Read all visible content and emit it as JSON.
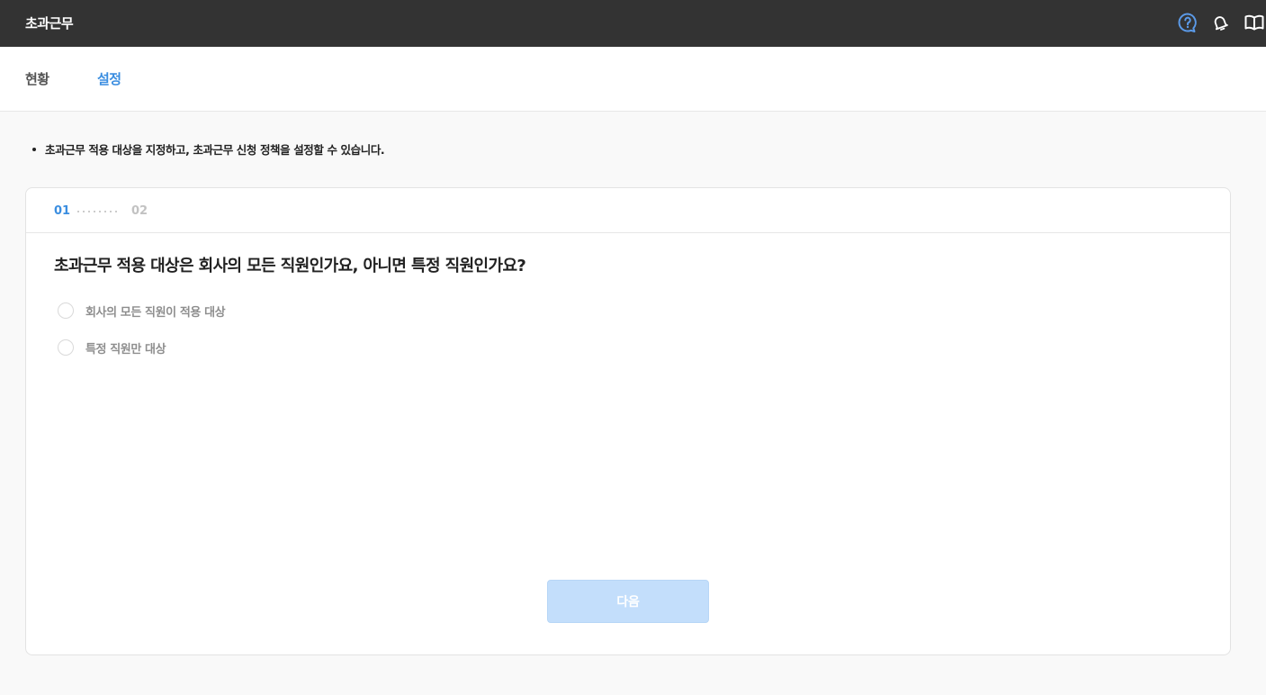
{
  "header": {
    "title": "초과근무",
    "icons": [
      "help-icon",
      "bell-icon",
      "book-icon"
    ],
    "accent_color": "#5b9ae8"
  },
  "tabs": [
    {
      "label": "현황",
      "active": false
    },
    {
      "label": "설정",
      "active": true
    }
  ],
  "notice": "초과근무 적용 대상을 지정하고, 초과근무 신청 정책을 설정할 수 있습니다.",
  "wizard": {
    "steps": [
      "01",
      "02"
    ],
    "current_step": "01",
    "question": "초과근무 적용 대상은 회사의 모든 직원인가요, 아니면 특정 직원인가요?",
    "options": [
      {
        "label": "회사의 모든 직원이 적용 대상",
        "selected": false
      },
      {
        "label": "특정 직원만 대상",
        "selected": false
      }
    ],
    "next_label": "다음",
    "next_disabled": true
  },
  "colors": {
    "topbar": "#333333",
    "active_tab": "#3b8ee0",
    "button_disabled": "#c3defb"
  }
}
